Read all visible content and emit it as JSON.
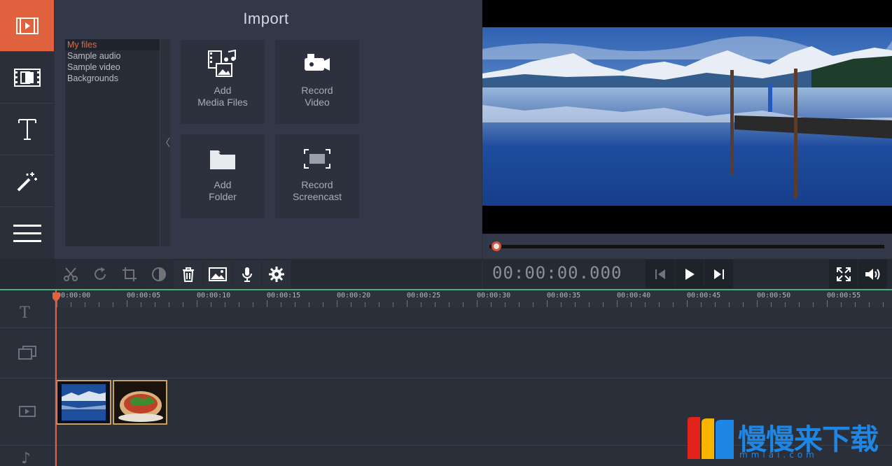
{
  "import": {
    "title": "Import",
    "categories": [
      "My files",
      "Sample audio",
      "Sample video",
      "Backgrounds"
    ],
    "collapse_glyph": "〈",
    "tiles": [
      {
        "icon": "add-media-icon",
        "label": "Add\nMedia Files"
      },
      {
        "icon": "record-video-icon",
        "label": "Record\nVideo"
      },
      {
        "icon": "folder-icon",
        "label": "Add\nFolder"
      },
      {
        "icon": "screencast-icon",
        "label": "Record\nScreencast"
      }
    ]
  },
  "sidebar": {
    "items": [
      "import-icon",
      "transitions-icon",
      "titles-icon",
      "filters-icon",
      "menu-icon"
    ],
    "active": 0
  },
  "toolbar": {
    "buttons": [
      "scissors-icon",
      "rotate-icon",
      "crop-icon",
      "color-icon",
      "trash-icon",
      "image-icon",
      "mic-icon",
      "gear-icon"
    ]
  },
  "player": {
    "timecode": "00:00:00.000",
    "progress": 0
  },
  "timeline": {
    "ticks": [
      "00:00:00",
      "00:00:05",
      "00:00:10",
      "00:00:15",
      "00:00:20",
      "00:00:25",
      "00:00:30",
      "00:00:35",
      "00:00:40",
      "00:00:45",
      "00:00:50",
      "00:00:55"
    ],
    "track_icons": [
      "T",
      "overlay-track-icon",
      "video-track-icon",
      "♪"
    ]
  },
  "watermark": {
    "text": "慢慢来下载",
    "url": "mmlai.com"
  },
  "colors": {
    "accent": "#e0623f",
    "timeline_line": "#4caf7b",
    "watermark": "#1e87e6"
  }
}
